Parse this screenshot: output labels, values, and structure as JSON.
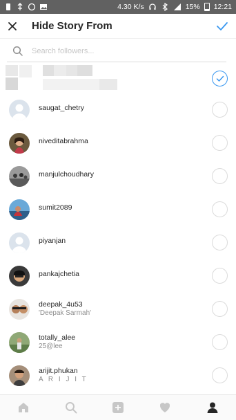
{
  "status_bar": {
    "speed": "4.30 K/s",
    "battery": "15%",
    "time": "12:21"
  },
  "header": {
    "title": "Hide Story From"
  },
  "search": {
    "placeholder": "Search followers..."
  },
  "followers": [
    {
      "username": "saugat_chetry",
      "subtitle": "",
      "avatar": "default-avatar",
      "selected": false
    },
    {
      "username": "niveditabrahma",
      "subtitle": "",
      "avatar": "photo-avatar",
      "selected": false
    },
    {
      "username": "manjulchoudhary",
      "subtitle": "",
      "avatar": "photo-avatar",
      "selected": false
    },
    {
      "username": "sumit2089",
      "subtitle": "",
      "avatar": "photo-avatar",
      "selected": false
    },
    {
      "username": "piyanjan",
      "subtitle": "",
      "avatar": "default-avatar",
      "selected": false
    },
    {
      "username": "pankajchetia",
      "subtitle": "",
      "avatar": "photo-avatar",
      "selected": false
    },
    {
      "username": "deepak_4u53",
      "subtitle": "'Deepak Sarmah'",
      "avatar": "photo-avatar",
      "selected": false
    },
    {
      "username": "totally_alee",
      "subtitle": "25@lee",
      "avatar": "photo-avatar",
      "selected": false
    },
    {
      "username": "arijit.phukan",
      "subtitle": "A R I J I T",
      "avatar": "photo-avatar",
      "selected": false
    }
  ],
  "colors": {
    "accent": "#3897f0",
    "text": "#262626",
    "muted": "#8e8e8e",
    "status_bar": "#616161"
  },
  "bottom_nav": [
    "home-icon",
    "search-icon",
    "add-post-icon",
    "activity-heart-icon",
    "profile-icon"
  ]
}
